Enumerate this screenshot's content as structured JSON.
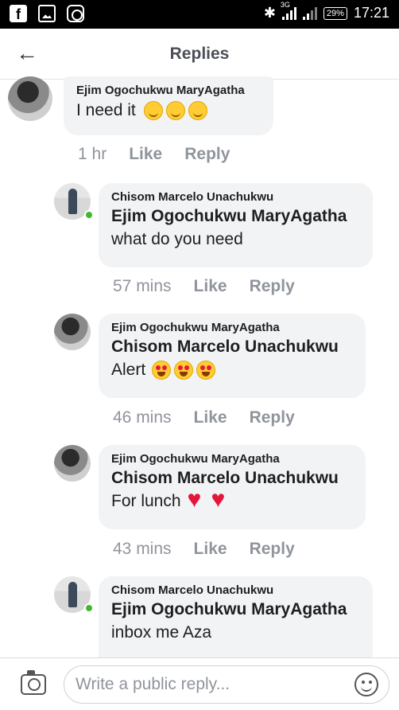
{
  "status_bar": {
    "network": "3G",
    "battery": "29%",
    "time": "17:21",
    "icons": [
      "facebook-icon",
      "gallery-icon",
      "instagram-icon",
      "bluetooth-icon",
      "signal-icon",
      "battery-icon"
    ]
  },
  "header": {
    "title": "Replies",
    "back_icon": "arrow-left-icon"
  },
  "comments": [
    {
      "author": "Ejim Ogochukwu MaryAgatha",
      "mention": "",
      "text": "I need it",
      "emojis": [
        "smile",
        "smile",
        "smile"
      ],
      "time": "1 hr",
      "like_label": "Like",
      "reply_label": "Reply",
      "online": false
    },
    {
      "author": "Chisom Marcelo Unachukwu",
      "mention": "Ejim Ogochukwu MaryAgatha",
      "text": "what do you need",
      "emojis": [],
      "time": "57 mins",
      "like_label": "Like",
      "reply_label": "Reply",
      "online": true
    },
    {
      "author": "Ejim Ogochukwu MaryAgatha",
      "mention": "Chisom Marcelo Unachukwu",
      "text": "Alert",
      "emojis": [
        "heart-eyes",
        "heart-eyes",
        "heart-eyes"
      ],
      "time": "46 mins",
      "like_label": "Like",
      "reply_label": "Reply",
      "online": false
    },
    {
      "author": "Ejim Ogochukwu MaryAgatha",
      "mention": "Chisom Marcelo Unachukwu",
      "text": "For lunch",
      "emojis": [
        "heart",
        "heart"
      ],
      "time": "43 mins",
      "like_label": "Like",
      "reply_label": "Reply",
      "online": false
    },
    {
      "author": "Chisom Marcelo Unachukwu",
      "mention": "Ejim Ogochukwu MaryAgatha",
      "text": "inbox me Aza",
      "emojis": [],
      "online": true
    }
  ],
  "composer": {
    "placeholder": "Write a public reply...",
    "camera_icon": "camera-icon",
    "emoji_icon": "emoji-icon"
  },
  "colors": {
    "bubble": "#f2f3f5",
    "meta_text": "#90949c",
    "online": "#42b72a"
  }
}
